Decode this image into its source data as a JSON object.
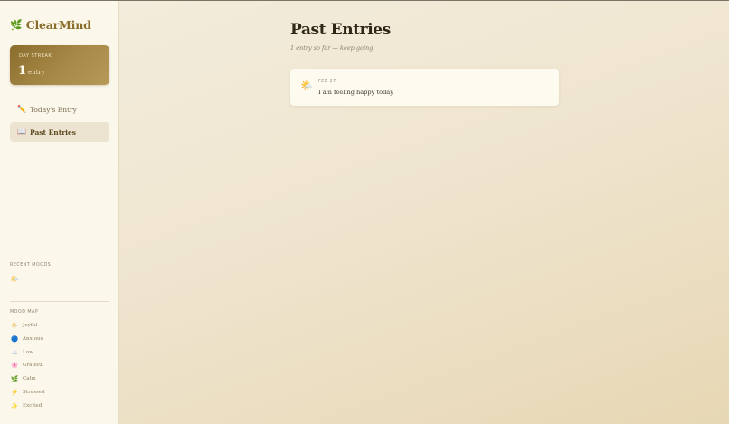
{
  "brand": {
    "icon": "leaf-icon",
    "name": "ClearMind"
  },
  "streak": {
    "label": "DAY STREAK",
    "value": "1",
    "unit": "entry"
  },
  "nav": [
    {
      "icon": "pencil-icon",
      "label": "Today's Entry",
      "active": false
    },
    {
      "icon": "book-icon",
      "label": "Past Entries",
      "active": true
    }
  ],
  "recent_moods": {
    "label": "RECENT MOODS",
    "items": [
      "sun-behind-cloud-icon"
    ]
  },
  "mood_map": {
    "label": "MOOD MAP",
    "items": [
      {
        "icon": "sun-behind-cloud-icon",
        "label": "Joyful"
      },
      {
        "icon": "blue-circle-icon",
        "label": "Anxious"
      },
      {
        "icon": "cloud-icon",
        "label": "Low"
      },
      {
        "icon": "blossom-icon",
        "label": "Grateful"
      },
      {
        "icon": "leaf-icon",
        "label": "Calm"
      },
      {
        "icon": "lightning-icon",
        "label": "Stressed"
      },
      {
        "icon": "sparkles-icon",
        "label": "Excited"
      }
    ]
  },
  "main": {
    "title": "Past Entries",
    "subtitle": "1 entry so far — keep going.",
    "entries": [
      {
        "icon": "sun-behind-cloud-icon",
        "date": "FEB 27",
        "text": "I am feeling happy today"
      }
    ]
  },
  "colors": {
    "accent": "#8a6d2b",
    "sidebar_bg": "#fbf7ea",
    "main_bg": "#efe5cf",
    "streak_gradient_start": "#8a6d2d",
    "streak_gradient_end": "#b89a58"
  }
}
